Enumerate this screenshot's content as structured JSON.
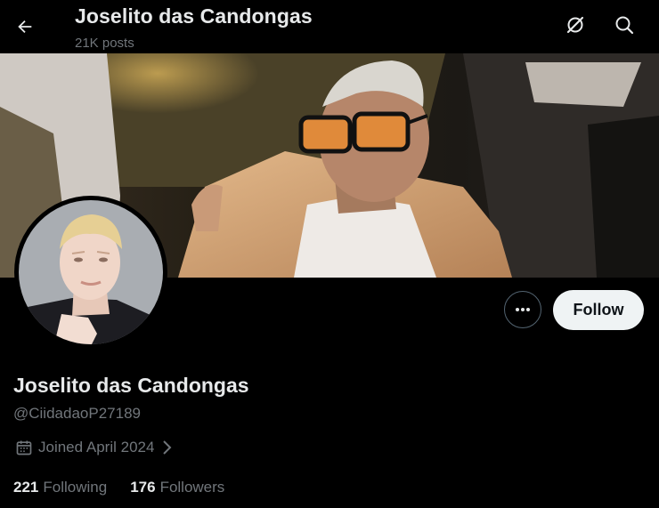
{
  "header": {
    "title": "Joselito das Candongas",
    "posts_count": "21K posts"
  },
  "icons": {
    "back": "back-arrow-icon",
    "grok": "grok-icon",
    "search": "search-icon",
    "more": "more-dots-icon",
    "calendar": "calendar-icon",
    "chevron": "chevron-right-icon"
  },
  "profile": {
    "display_name": "Joselito das Candongas",
    "handle": "@CiidadaoP27189",
    "joined": "Joined April 2024",
    "following_count": "221",
    "following_label": "Following",
    "followers_count": "176",
    "followers_label": "Followers"
  },
  "actions": {
    "follow_label": "Follow"
  },
  "colors": {
    "background": "#000000",
    "text_primary": "#e7e9ea",
    "text_secondary": "#71767b",
    "follow_bg": "#eff3f4",
    "follow_text": "#0f1419",
    "border": "#536471"
  }
}
